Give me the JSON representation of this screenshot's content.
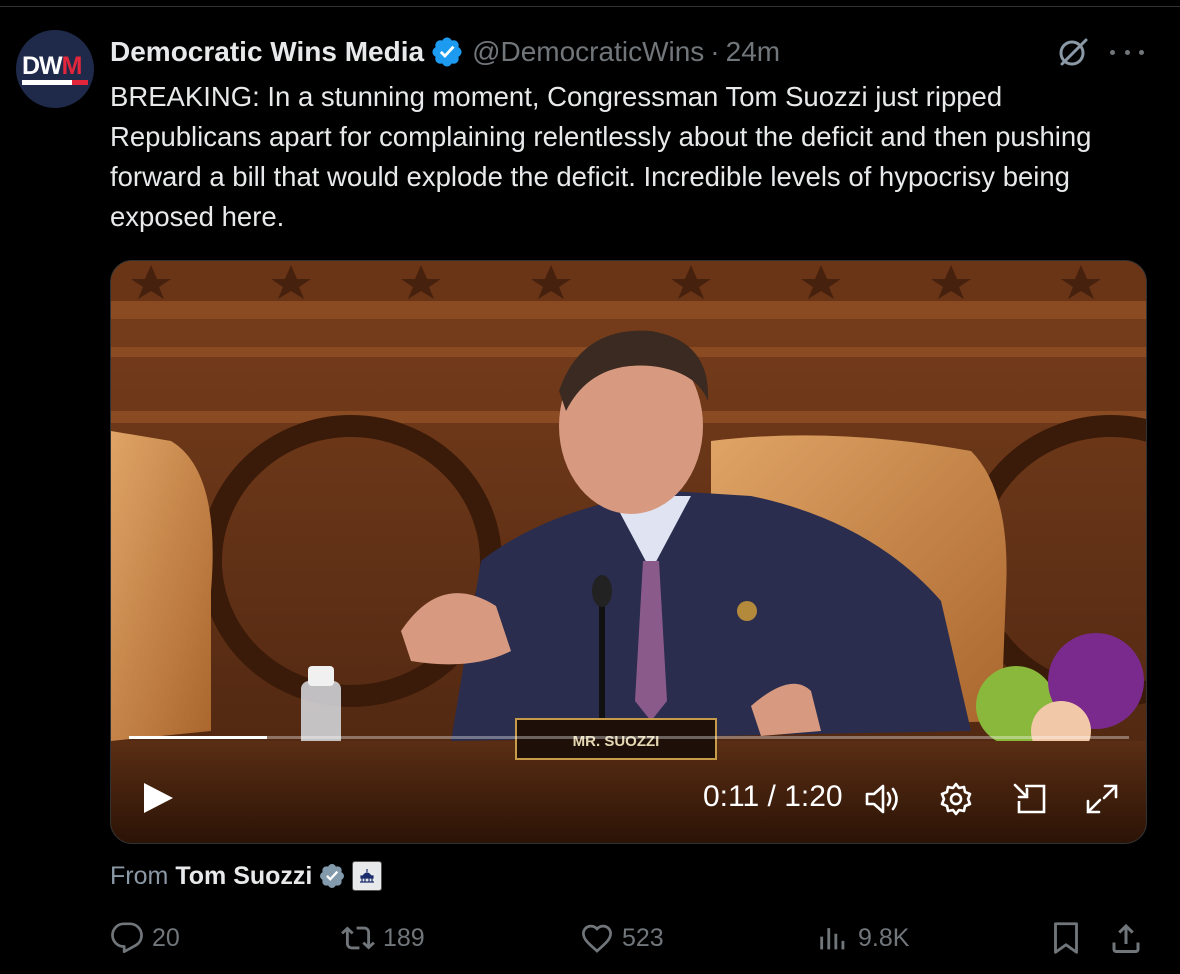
{
  "tweet": {
    "author_name": "Democratic Wins Media",
    "author_handle": "@DemocraticWins",
    "separator": "·",
    "time": "24m",
    "avatar_text_1": "DW",
    "avatar_text_2": "M",
    "text": "BREAKING: In a stunning moment, Congressman Tom Suozzi just ripped Republicans apart for complaining relentlessly about the deficit and then pushing forward a bill that would explode the deficit. Incredible levels of hypocrisy being exposed here.",
    "icons": [
      "verified-badge-icon",
      "grok-icon",
      "more-icon"
    ]
  },
  "video": {
    "nameplate": "MR. SUOZZI",
    "current_time": "0:11",
    "time_sep": " / ",
    "duration": "1:20",
    "progress_fraction": 0.138,
    "controls": [
      "play-icon",
      "volume-icon",
      "settings-icon",
      "picture-in-picture-icon",
      "fullscreen-icon"
    ]
  },
  "attribution": {
    "prefix": "From",
    "name": "Tom Suozzi"
  },
  "actions": {
    "replies": "20",
    "reposts": "189",
    "likes": "523",
    "views": "9.8K"
  },
  "colors": {
    "background": "#000000",
    "text": "#e7e9ea",
    "muted": "#71767b",
    "verified": "#1d9bf0"
  }
}
